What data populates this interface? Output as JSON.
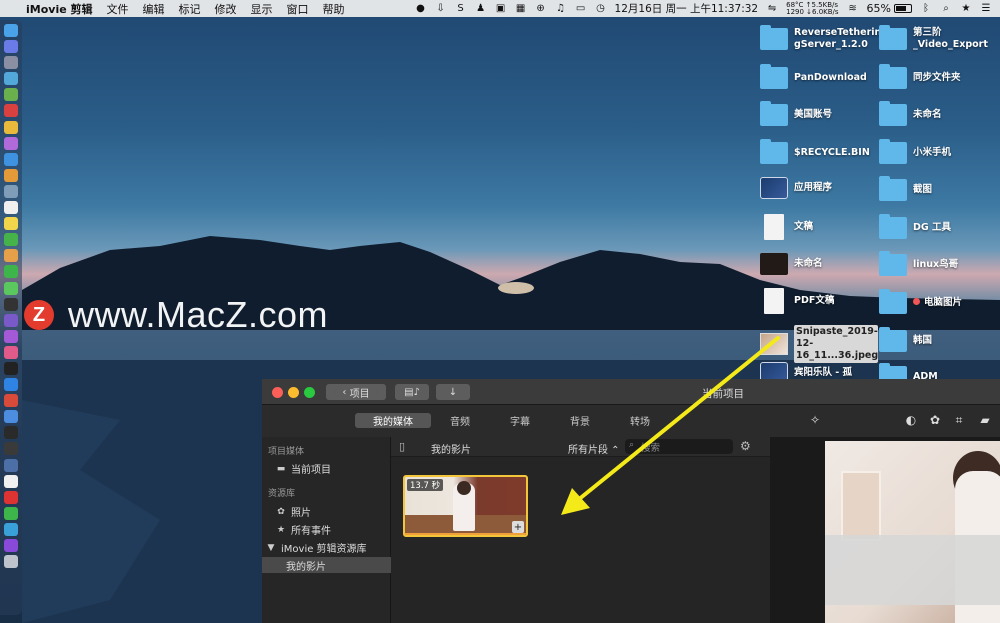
{
  "menubar": {
    "apple_icon": "apple-logo-icon",
    "app_name": "iMovie 剪辑",
    "menus": [
      "文件",
      "编辑",
      "标记",
      "修改",
      "显示",
      "窗口",
      "帮助"
    ],
    "clock": "12月16日 周一 上午11:37:32",
    "net_line1": "68°C ↑5.5KB/s",
    "net_line2": "1290 ↓6.0KB/s",
    "battery_pct": "65%",
    "battery_level": 0.65
  },
  "watermark": {
    "logo_letter": "Z",
    "text": "www.MacZ.com"
  },
  "desktop_icons": [
    {
      "label": "ReverseTetherin gServer_1.2.0",
      "kind": "folder"
    },
    {
      "label": "第三阶 _Video_Export",
      "kind": "folder"
    },
    {
      "label": "PanDownload",
      "kind": "folder"
    },
    {
      "label": "同步文件夹",
      "kind": "folder"
    },
    {
      "label": "美国账号",
      "kind": "folder"
    },
    {
      "label": "未命名",
      "kind": "folder"
    },
    {
      "label": "$RECYCLE.BIN",
      "kind": "folder"
    },
    {
      "label": "小米手机",
      "kind": "folder"
    },
    {
      "label": "应用程序",
      "kind": "app"
    },
    {
      "label": "截图",
      "kind": "folder"
    },
    {
      "label": "文稿",
      "kind": "document"
    },
    {
      "label": "DG 工具",
      "kind": "folder"
    },
    {
      "label": "未命名",
      "kind": "dark"
    },
    {
      "label": "linux鸟哥",
      "kind": "folder"
    },
    {
      "label": "PDF文稿",
      "kind": "document"
    },
    {
      "label": "电脑图片",
      "kind": "folder"
    },
    {
      "label": "Snipaste_2019-12-16_11...36.jpeg",
      "kind": "image"
    },
    {
      "label": "韩国",
      "kind": "folder"
    },
    {
      "label": "宾阳乐队 - 孤",
      "kind": "app"
    },
    {
      "label": "ADM",
      "kind": "folder"
    }
  ],
  "imovie": {
    "window_title": "当前项目",
    "back_button": "项目",
    "tabs": [
      "我的媒体",
      "音频",
      "字幕",
      "背景",
      "转场"
    ],
    "sidebar": {
      "section1": "项目媒体",
      "current_project": "当前项目",
      "section2": "资源库",
      "photos": "照片",
      "all_events": "所有事件",
      "library": "iMovie 剪辑资源库",
      "my_movie": "我的影片"
    },
    "browser": {
      "title": "我的影片",
      "filter": "所有片段",
      "search_placeholder": "搜索"
    },
    "clip": {
      "duration": "13.7 秒"
    }
  },
  "colors": {
    "folder": "#5fb8e9",
    "clip_selection": "#f2c53b",
    "arrow": "#f4ea1a",
    "watermark_logo": "#e33b2e"
  }
}
